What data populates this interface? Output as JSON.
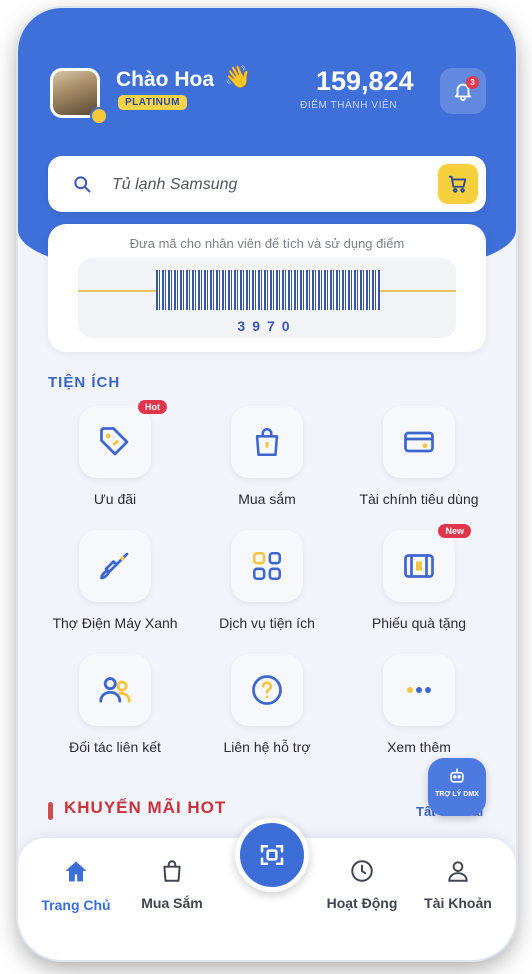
{
  "header": {
    "greeting": "Chào Hoa",
    "wave_emoji": "👋",
    "tier": "PLATINUM",
    "points": "159,824",
    "points_label": "ĐIỂM THÀNH VIÊN",
    "notification_count": "3"
  },
  "search": {
    "value": "Tủ lạnh Samsung"
  },
  "barcode": {
    "hint": "Đưa mã cho nhân viên để tích và sử dụng điểm",
    "number": "3970"
  },
  "utilities": {
    "title": "TIỆN ÍCH",
    "items": [
      {
        "label": "Ưu đãi",
        "icon": "tag-icon",
        "badge": "Hot"
      },
      {
        "label": "Mua sắm",
        "icon": "shopping-bag-icon"
      },
      {
        "label": "Tài chính tiêu dùng",
        "icon": "card-icon"
      },
      {
        "label": "Thợ Điện Máy Xanh",
        "icon": "brush-icon"
      },
      {
        "label": "Dịch vụ tiện ích",
        "icon": "grid-icon"
      },
      {
        "label": "Phiếu quà tặng",
        "icon": "voucher-icon",
        "badge": "New"
      },
      {
        "label": "Đối tác liên kết",
        "icon": "partners-icon"
      },
      {
        "label": "Liên hệ hỗ trợ",
        "icon": "question-icon"
      },
      {
        "label": "Xem thêm",
        "icon": "more-icon"
      }
    ]
  },
  "assistant": {
    "label": "TRỢ LÝ DMX"
  },
  "promo": {
    "title": "KHUYẾN MÃI HOT",
    "see_all": "Tất cả deal"
  },
  "nav": {
    "items": [
      {
        "label": "Trang Chủ",
        "icon": "home-icon",
        "active": true
      },
      {
        "label": "Mua Sắm",
        "icon": "bag-icon"
      },
      {
        "label": "Hoạt Động",
        "icon": "clock-icon"
      },
      {
        "label": "Tài Khoản",
        "icon": "user-icon"
      }
    ]
  },
  "colors": {
    "primary": "#3f6fd8",
    "accent_yellow": "#f6cf3c",
    "badge_red": "#e0364d"
  }
}
